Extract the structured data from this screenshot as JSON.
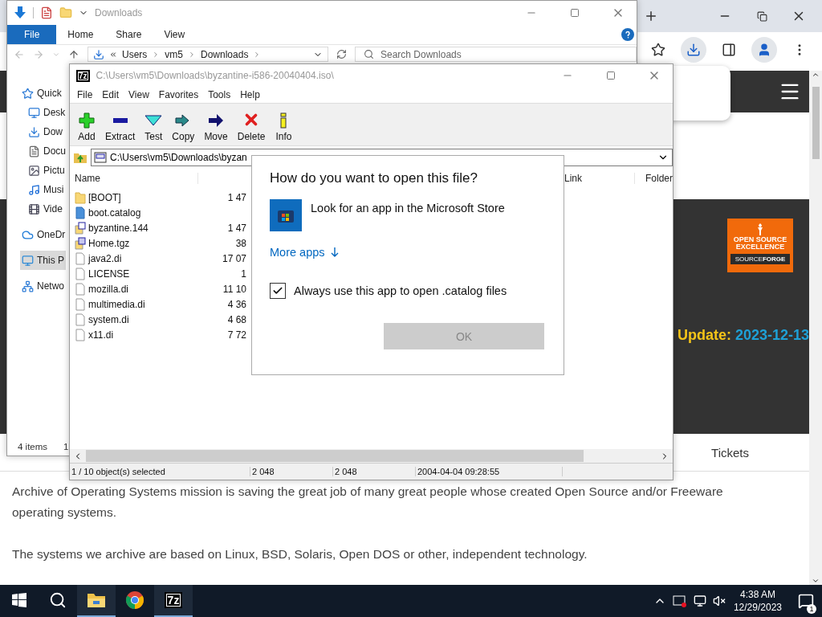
{
  "browser": {
    "site": {
      "badge": {
        "line_1": "OPEN SOURCE",
        "line_2": "EXCELLENCE",
        "brand": "SOURCE**FORGE**"
      },
      "update": {
        "label": "Update:",
        "date": "2023-12-13"
      },
      "nav": [
        "Tickets"
      ],
      "paragraphs": [
        "Archive of Operating Systems mission is saving the great job of many great people whose created Open Source and/or Freeware operating systems.",
        "The systems we archive are based on Linux, BSD, Solaris, Open DOS or other, independent technology."
      ]
    }
  },
  "explorer": {
    "title": "Downloads",
    "ribbon_tabs": [
      {
        "label": "File",
        "selected": true
      },
      {
        "label": "Home",
        "selected": false
      },
      {
        "label": "Share",
        "selected": false
      },
      {
        "label": "View",
        "selected": false
      }
    ],
    "breadcrumb": [
      "Users",
      "vm5",
      "Downloads"
    ],
    "search": {
      "placeholder": "Search Downloads"
    },
    "nav_items": [
      {
        "label": "Quick",
        "kind": "star",
        "selected": false
      },
      {
        "label": "Desk",
        "kind": "desktop",
        "selected": false
      },
      {
        "label": "Dow",
        "kind": "download",
        "selected": false
      },
      {
        "label": "Docu",
        "kind": "document",
        "selected": false
      },
      {
        "label": "Pictu",
        "kind": "picture",
        "selected": false
      },
      {
        "label": "Musi",
        "kind": "music",
        "selected": false
      },
      {
        "label": "Vide",
        "kind": "video",
        "selected": false
      },
      {
        "label": "OneDr",
        "kind": "cloud",
        "selected": false
      },
      {
        "label": "This P",
        "kind": "pc",
        "selected": true
      },
      {
        "label": "Netwo",
        "kind": "network",
        "selected": false
      }
    ],
    "status": [
      "4 items",
      "1"
    ]
  },
  "archive_window": {
    "app_badge": "7z",
    "title": "C:\\Users\\vm5\\Downloads\\byzantine-i586-20040404.iso\\",
    "menu": [
      "File",
      "Edit",
      "View",
      "Favorites",
      "Tools",
      "Help"
    ],
    "toolbar": [
      {
        "label": "Add",
        "kind": "add"
      },
      {
        "label": "Extract",
        "kind": "extract"
      },
      {
        "label": "Test",
        "kind": "test"
      },
      {
        "label": "Copy",
        "kind": "copy"
      },
      {
        "label": "Move",
        "kind": "move"
      },
      {
        "label": "Delete",
        "kind": "delete"
      },
      {
        "label": "Info",
        "kind": "info"
      }
    ],
    "path": "C:\\Users\\vm5\\Downloads\\byzan",
    "columns": [
      "Name",
      "Link",
      "Folder"
    ],
    "rows": [
      {
        "name": "[BOOT]",
        "size": "1 47",
        "kind": "folder"
      },
      {
        "name": "boot.catalog",
        "size": "",
        "kind": "catalog"
      },
      {
        "name": "byzantine.144",
        "size": "1 47",
        "kind": "image"
      },
      {
        "name": "Home.tgz",
        "size": "38",
        "kind": "archive"
      },
      {
        "name": "java2.di",
        "size": "17 07",
        "kind": "file"
      },
      {
        "name": "LICENSE",
        "size": "1",
        "kind": "file"
      },
      {
        "name": "mozilla.di",
        "size": "11 10",
        "kind": "file"
      },
      {
        "name": "multimedia.di",
        "size": "4 36",
        "kind": "file"
      },
      {
        "name": "system.di",
        "size": "4 68",
        "kind": "file"
      },
      {
        "name": "x11.di",
        "size": "7 72",
        "kind": "file"
      }
    ],
    "status": [
      "1 / 10 object(s) selected",
      "2 048",
      "2 048",
      "2004-04-04 09:28:55"
    ]
  },
  "dialog": {
    "title": "How do you want to open this file?",
    "option": "Look for an app in the Microsoft Store",
    "more_link": "More apps",
    "checkbox": {
      "label": "Always use this app to open .catalog files",
      "checked": true
    },
    "ok_button": {
      "label": "OK",
      "disabled": true
    }
  },
  "taskbar": {
    "apps": [
      {
        "kind": "explorer",
        "active": true
      },
      {
        "kind": "chrome",
        "active": false
      },
      {
        "kind": "sevenzip",
        "label": "7z",
        "active": true
      }
    ],
    "time": "4:38 AM",
    "date": "12/29/2023",
    "notifications": "1"
  }
}
